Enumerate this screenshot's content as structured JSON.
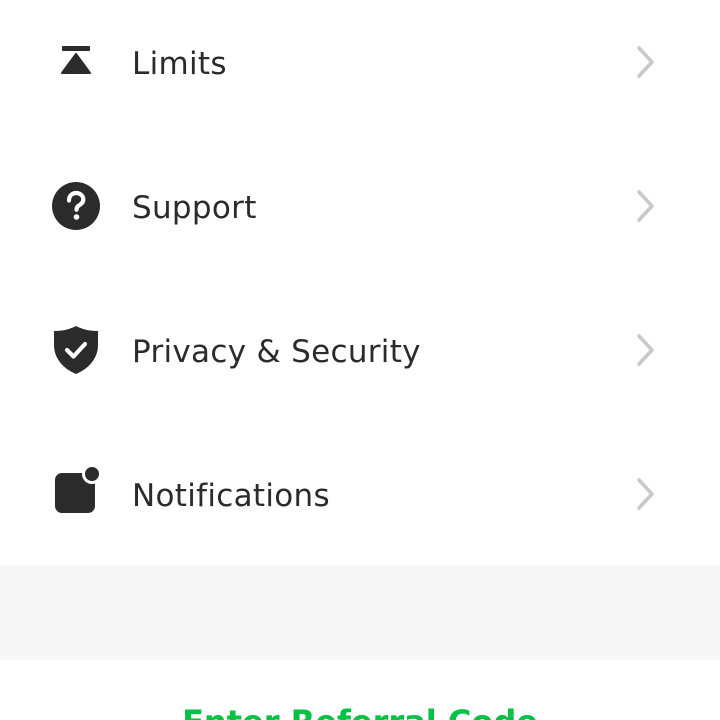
{
  "menu": {
    "items": [
      {
        "label": "Limits",
        "icon": "limits-icon"
      },
      {
        "label": "Support",
        "icon": "question-circle-icon"
      },
      {
        "label": "Privacy & Security",
        "icon": "shield-check-icon"
      },
      {
        "label": "Notifications",
        "icon": "notification-badge-icon"
      }
    ]
  },
  "referral": {
    "label": "Enter Referral Code"
  },
  "colors": {
    "text": "#2b2b2b",
    "icon": "#2b2b2b",
    "chevron": "#c8c8c8",
    "accent": "#00c244",
    "section_bg": "#f7f7f7"
  }
}
